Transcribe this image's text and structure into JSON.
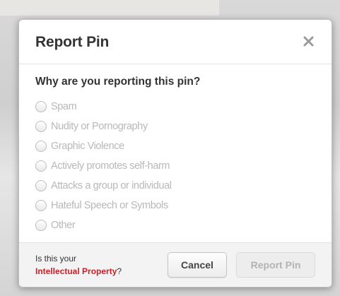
{
  "dialog": {
    "title": "Report Pin",
    "close_icon": "close-icon",
    "question": "Why are you reporting this pin?",
    "options": [
      {
        "label": "Spam",
        "selected": false
      },
      {
        "label": "Nudity or Pornography",
        "selected": false
      },
      {
        "label": "Graphic Violence",
        "selected": false
      },
      {
        "label": "Actively promotes self-harm",
        "selected": false
      },
      {
        "label": "Attacks a group or individual",
        "selected": false
      },
      {
        "label": "Hateful Speech or Symbols",
        "selected": false
      },
      {
        "label": "Other",
        "selected": false
      }
    ]
  },
  "footer": {
    "ip_prompt": "Is this your",
    "ip_link": "Intellectual Property",
    "ip_suffix": "?",
    "cancel_label": "Cancel",
    "report_label": "Report Pin",
    "report_enabled": false
  },
  "colors": {
    "link": "#cb2027",
    "disabled_text": "#b8b8b8",
    "title_text": "#333333"
  }
}
